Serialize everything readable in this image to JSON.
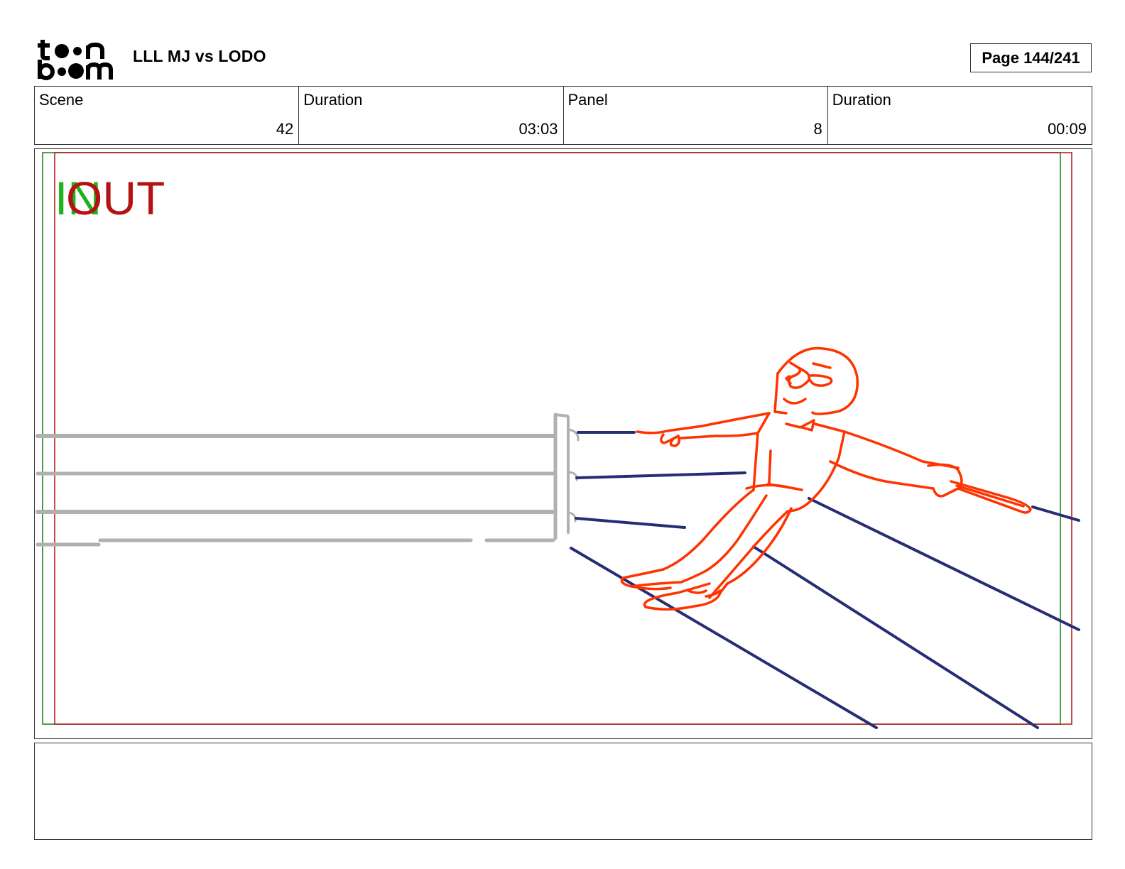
{
  "header": {
    "logo_text": "toon boom",
    "project_title": "LLL MJ vs LODO",
    "page_label": "Page 144/241"
  },
  "info": {
    "scene_label": "Scene",
    "scene_value": "42",
    "scene_duration_label": "Duration",
    "scene_duration_value": "03:03",
    "panel_label": "Panel",
    "panel_value": "8",
    "panel_duration_label": "Duration",
    "panel_duration_value": "00:09"
  },
  "panel": {
    "in_label": "IN",
    "out_label": "OUT",
    "colors": {
      "in_green": "#1bb51b",
      "out_red": "#b51313",
      "character": "#ff3300",
      "ring_ropes": "#262d75",
      "background_ropes": "#b0b0b0"
    }
  },
  "notes": {
    "text": ""
  }
}
